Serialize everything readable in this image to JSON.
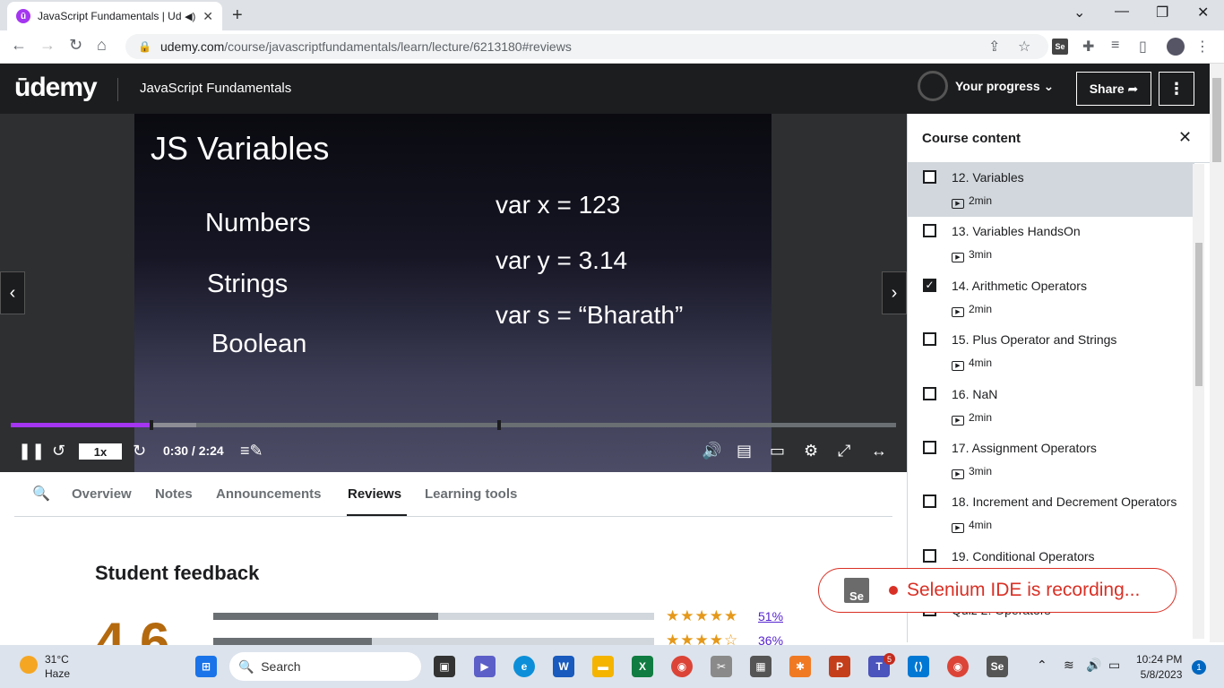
{
  "browser": {
    "tab_title": "JavaScript Fundamentals | Ud",
    "url_host": "udemy.com",
    "url_path": "/course/javascriptfundamentals/learn/lecture/6213180#reviews"
  },
  "header": {
    "logo": "ūdemy",
    "course_title": "JavaScript Fundamentals",
    "progress_label": "Your progress",
    "share_label": "Share"
  },
  "slide": {
    "title": "JS Variables",
    "left_items": [
      "Numbers",
      "Strings",
      "Boolean"
    ],
    "code_lines": [
      "var x =  123",
      "var y = 3.14",
      "var s = “Bharath”"
    ]
  },
  "player": {
    "speed": "1x",
    "time": "0:30 / 2:24",
    "progress_fraction": 0.158,
    "buffered_fraction": 0.21
  },
  "tabs": [
    "Overview",
    "Notes",
    "Announcements",
    "Reviews",
    "Learning tools"
  ],
  "active_tab": "Reviews",
  "feedback": {
    "title": "Student feedback",
    "rating": "4.6",
    "rows": [
      {
        "stars": "★★★★★",
        "pct": "51%",
        "fill": 0.51
      },
      {
        "stars": "★★★★☆",
        "pct": "36%",
        "fill": 0.36
      }
    ]
  },
  "sidebar": {
    "title": "Course content",
    "lectures": [
      {
        "title": "12. Variables",
        "duration": "2min",
        "checked": false,
        "current": true
      },
      {
        "title": "13. Variables HandsOn",
        "duration": "3min",
        "checked": false,
        "current": false
      },
      {
        "title": "14. Arithmetic Operators",
        "duration": "2min",
        "checked": true,
        "current": false
      },
      {
        "title": "15. Plus Operator and Strings",
        "duration": "4min",
        "checked": false,
        "current": false
      },
      {
        "title": "16. NaN",
        "duration": "2min",
        "checked": false,
        "current": false
      },
      {
        "title": "17. Assignment Operators",
        "duration": "3min",
        "checked": false,
        "current": false
      },
      {
        "title": "18. Increment and Decrement Operators",
        "duration": "4min",
        "checked": false,
        "current": false
      },
      {
        "title": "19. Conditional Operators",
        "duration": "",
        "checked": false,
        "current": false
      },
      {
        "title": "Quiz 2: Operators",
        "duration": "",
        "checked": false,
        "current": false
      }
    ]
  },
  "selenium": {
    "logo": "Se",
    "text": "Selenium IDE is recording..."
  },
  "taskbar": {
    "temp": "31°C",
    "weather": "Haze",
    "search_placeholder": "Search",
    "time": "10:24 PM",
    "date": "5/8/2023",
    "notification_count": "1",
    "teams_badge": "5"
  },
  "colors": {
    "accent": "#a435f0",
    "rating": "#b4690e",
    "stars": "#e59819",
    "recording": "#d93025"
  }
}
